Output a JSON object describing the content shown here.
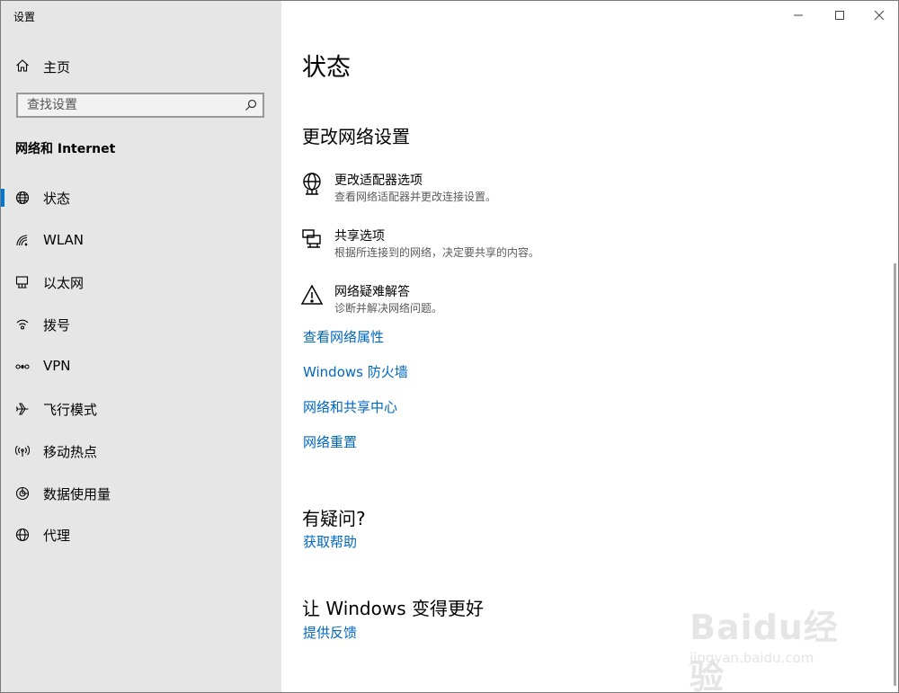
{
  "window": {
    "app_title": "设置",
    "controls": [
      "minimize-icon",
      "maximize-icon",
      "close-icon"
    ]
  },
  "sidebar": {
    "home_label": "主页",
    "search_placeholder": "查找设置",
    "section_title": "网络和 Internet",
    "items": [
      {
        "label": "状态",
        "icon": "globe-icon",
        "active": true
      },
      {
        "label": "WLAN",
        "icon": "wifi-icon",
        "active": false
      },
      {
        "label": "以太网",
        "icon": "ethernet-icon",
        "active": false
      },
      {
        "label": "拨号",
        "icon": "dialup-icon",
        "active": false
      },
      {
        "label": "VPN",
        "icon": "vpn-icon",
        "active": false
      },
      {
        "label": "飞行模式",
        "icon": "airplane-icon",
        "active": false
      },
      {
        "label": "移动热点",
        "icon": "hotspot-icon",
        "active": false
      },
      {
        "label": "数据使用量",
        "icon": "data-usage-icon",
        "active": false
      },
      {
        "label": "代理",
        "icon": "proxy-globe-icon",
        "active": false
      }
    ]
  },
  "main": {
    "title": "状态",
    "change_section": {
      "heading": "更改网络设置",
      "options": [
        {
          "title": "更改适配器选项",
          "desc": "查看网络适配器并更改连接设置。",
          "icon": "adapter-icon"
        },
        {
          "title": "共享选项",
          "desc": "根据所连接到的网络，决定要共享的内容。",
          "icon": "sharing-icon"
        },
        {
          "title": "网络疑难解答",
          "desc": "诊断并解决网络问题。",
          "icon": "warning-icon"
        }
      ],
      "links": [
        "查看网络属性",
        "Windows 防火墙",
        "网络和共享中心",
        "网络重置"
      ]
    },
    "question_section": {
      "heading": "有疑问?",
      "link": "获取帮助"
    },
    "feedback_section": {
      "heading": "让 Windows 变得更好",
      "link": "提供反馈"
    }
  },
  "watermark": {
    "big": "Baidu经验",
    "small": "jingyan.baidu.com"
  },
  "colors": {
    "accent": "#0078d7",
    "link": "#0067c0",
    "sidebar_bg": "#e6e6e6"
  }
}
